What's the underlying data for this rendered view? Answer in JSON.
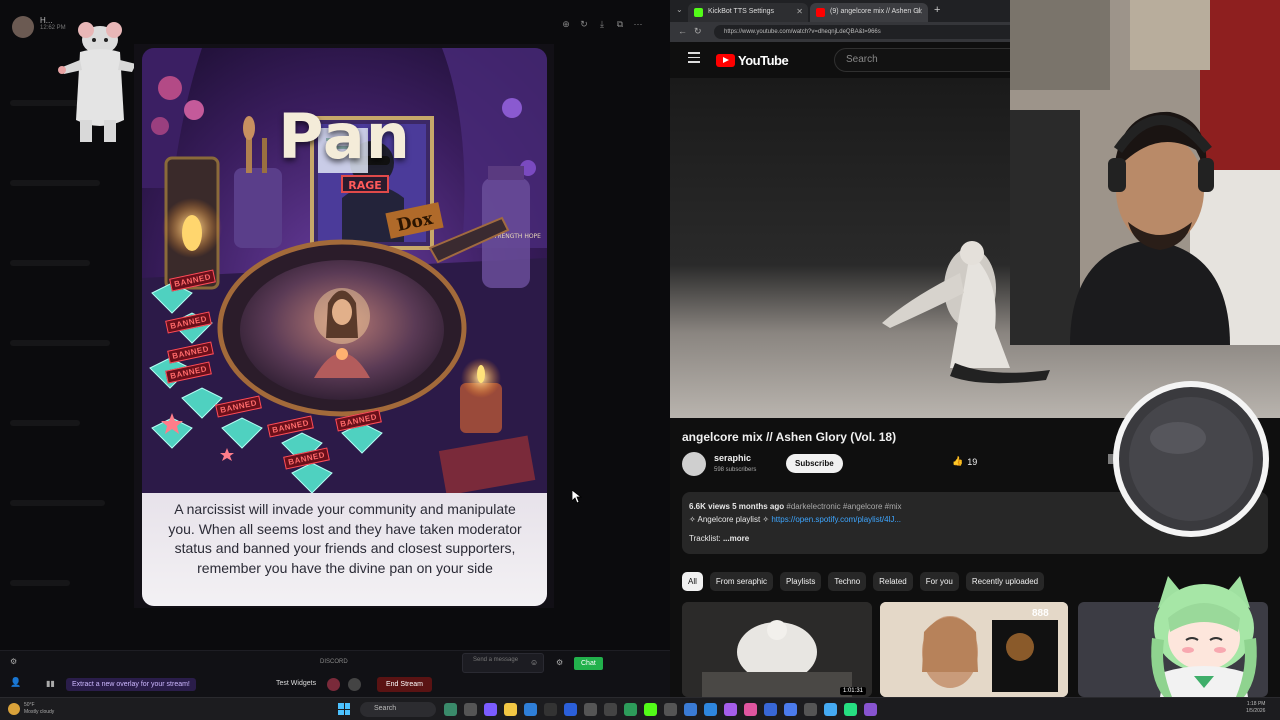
{
  "viewer": {
    "user_name": "H...",
    "time": "12:62 PM"
  },
  "card": {
    "title": "Pan",
    "body": "A narcissist will invade your community and manipulate you. When all seems lost and they have taken moderator status and banned your friends and closest supporters, remember you have the divine pan on your side",
    "art_labels": {
      "rage": "RAGE",
      "dox": "Dox",
      "banned": "BANNED",
      "jar": "FAITH STRENGTH HOPE"
    }
  },
  "streambar": {
    "discord": "DISCORD",
    "overlay_promo": "Extract a new overlay for your stream!",
    "test_widgets": "Test Widgets",
    "end_stream": "End Stream",
    "send_message": "Send a message",
    "chat": "Chat"
  },
  "browser": {
    "tabs": [
      {
        "label": "KickBot TTS Settings",
        "color": "#53fc18"
      },
      {
        "label": "(9) angelcore mix // Ashen Gl",
        "color": "#ff0000"
      }
    ],
    "url": "https://www.youtube.com/watch?v=dheqnjLdeQBA&t=966s"
  },
  "youtube": {
    "logo_text": "YouTube",
    "search_placeholder": "Search",
    "video_title": "angelcore mix // Ashen Glory (Vol. 18)",
    "channel_name": "seraphic",
    "subscribers": "598 subscribers",
    "subscribe_label": "Subscribe",
    "like_count": "19",
    "description": {
      "views_age": "6.6K views  5 months ago",
      "tags": "#darkelectronic #angelcore #mix",
      "playlist_label": "✧ Angelcore playlist ✧",
      "playlist_link": "https://open.spotify.com/playlist/4lJ...",
      "tracklist": "Tracklist:",
      "more": "...more"
    },
    "chips": [
      "All",
      "From seraphic",
      "Playlists",
      "Techno",
      "Related",
      "For you",
      "Recently uploaded"
    ],
    "thumbnails": [
      {
        "duration": "1:01:31"
      },
      {
        "text": "888"
      }
    ]
  },
  "taskbar": {
    "weather_temp": "50°F",
    "weather_desc": "Mostly cloudy",
    "search": "Search",
    "time": "1:18 PM",
    "date": "1/5/2026"
  },
  "colors": {
    "youtube_red": "#ff0000",
    "kick_green": "#53fc18",
    "link_blue": "#3ea6ff",
    "card_purple": "#2b1747"
  }
}
